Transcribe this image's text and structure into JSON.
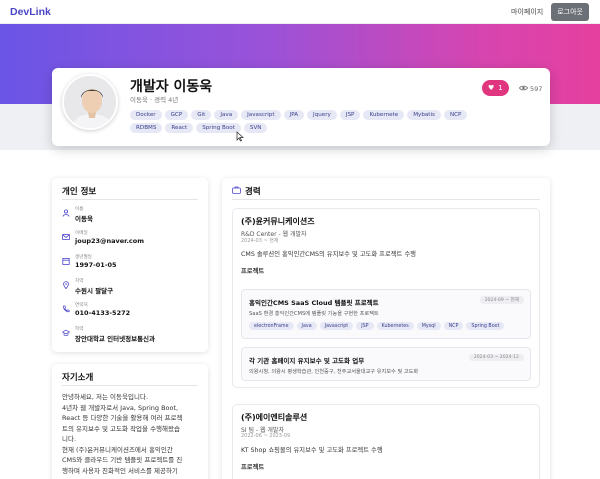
{
  "nav": {
    "brand": "DevLink",
    "mypage": "마이페이지",
    "logout": "로그아웃"
  },
  "profile": {
    "name": "개발자 이동욱",
    "subtitle": "이동욱 · 경력 4년",
    "likes": "1",
    "views": "597",
    "tags": [
      "Docker",
      "GCP",
      "Git",
      "Java",
      "Javascript",
      "JPA",
      "Jquery",
      "JSP",
      "Kubernete",
      "Mybatis",
      "NCP",
      "RDBMS",
      "React",
      "Spring Boot",
      "SVN"
    ]
  },
  "info": {
    "title": "개인 정보",
    "rows": [
      {
        "label": "이름",
        "value": "이동욱",
        "icon": "person-icon"
      },
      {
        "label": "이메일",
        "value": "joup23@naver.com",
        "icon": "mail-icon"
      },
      {
        "label": "생년월일",
        "value": "1997-01-05",
        "icon": "calendar-icon"
      },
      {
        "label": "지역",
        "value": "수원시 팔달구",
        "icon": "location-icon"
      },
      {
        "label": "연락처",
        "value": "010-4133-5272",
        "icon": "phone-icon"
      },
      {
        "label": "학력",
        "value": "장안대학교 인터넷정보통신과",
        "icon": "school-icon"
      }
    ]
  },
  "intro": {
    "title": "자기소개",
    "lines": [
      "안녕하세요, 저는 이동욱입니다.",
      "4년차 웹 개발자로서 Java, Spring Boot,",
      "React 등 다양한 기술을 활용해 여러 프로젝",
      "트의 유지보수 및 고도화 작업을 수행해왔습",
      "니다.",
      "현재 (주)윤커뮤니케이션즈에서 홍익인간",
      "CMS와 클라우드 기반 템플릿 프로젝트를 진",
      "행하며 사용자 친화적인 서비스를 제공하기"
    ]
  },
  "career": {
    "title": "경력",
    "companies": [
      {
        "name": "(주)윤커뮤니케이션즈",
        "role": "R&D Center - 웹 개발자",
        "date": "2024-03 ~ 현재",
        "desc": "CMS 솔루션인 홍익인간CMS의 유지보수 및 고도화 프로젝트 수행",
        "projects_label": "프로젝트",
        "projects": [
          {
            "name": "홍익인간CMS SaaS Cloud 템플릿 프로젝트",
            "date": "2024-09 ~ 현재",
            "desc": "SaaS 환경 홍익인간CMS에 템플릿 기능을 구현한 프로젝트",
            "tags": [
              "electronFrame",
              "Java",
              "Javascript",
              "JSP",
              "Kubernetes",
              "Mysql",
              "NCP",
              "Spring Boot"
            ]
          },
          {
            "name": "각 기관 홈페이지 유지보수 및 고도화 업무",
            "date": "2024-03 ~ 2024-12",
            "desc": "의왕시청, 의왕시 평생학습관, 인천중구, 천주교서울대교구 유지보수 및 고도화",
            "tags": []
          }
        ]
      },
      {
        "name": "(주)에이엔티솔루션",
        "role": "SI 팀 - 웹 개발자",
        "date": "2022-06 ~ 2023-09",
        "desc": "KT Shop 쇼핑몰의 유지보수 및 고도화 프로젝트 수행",
        "projects_label": "프로젝트"
      }
    ]
  }
}
